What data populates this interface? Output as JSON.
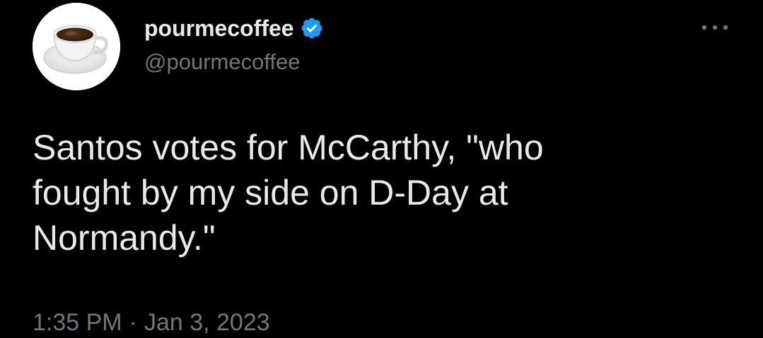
{
  "author": {
    "display_name": "pourmecoffee",
    "handle": "@pourmecoffee",
    "verified": true,
    "avatar_icon": "coffee-cup-icon",
    "verified_color": "#1d9bf0"
  },
  "tweet": {
    "text": "Santos votes for McCarthy, \"who\nfought by my side on D-Day at\nNormandy.\"",
    "time": "1:35 PM",
    "separator": "·",
    "date": "Jan 3, 2023"
  },
  "more_icon": "more-horizontal-icon",
  "colors": {
    "background": "#000000",
    "primary_text": "#e7e9ea",
    "secondary_text": "#71767b"
  }
}
